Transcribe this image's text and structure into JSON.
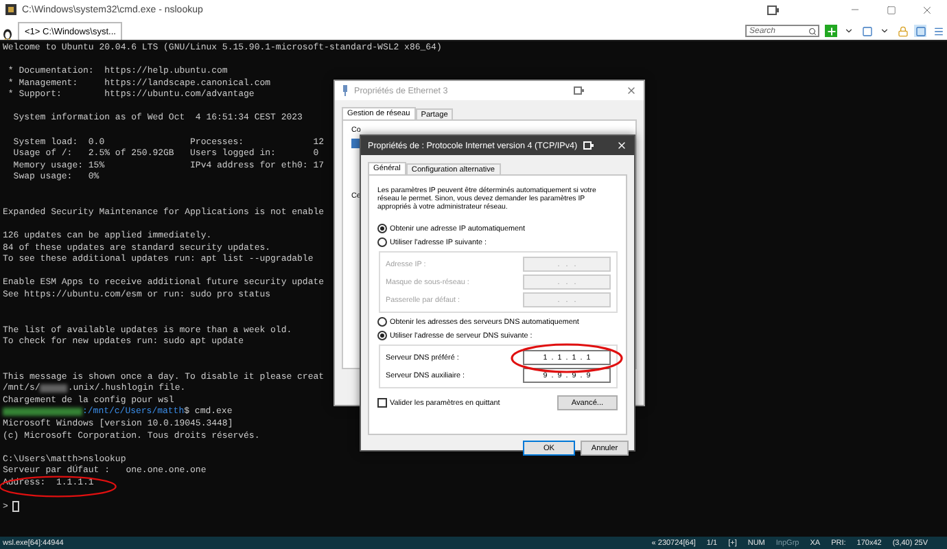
{
  "window": {
    "title": "C:\\Windows\\system32\\cmd.exe - nslookup"
  },
  "tabs": [
    {
      "label": "<1> C:\\Windows\\syst...",
      "selected": true
    }
  ],
  "search": {
    "placeholder": "Search"
  },
  "terminal": {
    "lines": [
      {
        "kind": "text",
        "text": "Welcome to Ubuntu 20.04.6 LTS (GNU/Linux 5.15.90.1-microsoft-standard-WSL2 x86_64)"
      },
      {
        "kind": "blank"
      },
      {
        "kind": "text",
        "text": " * Documentation:  https://help.ubuntu.com"
      },
      {
        "kind": "text",
        "text": " * Management:     https://landscape.canonical.com"
      },
      {
        "kind": "text",
        "text": " * Support:        https://ubuntu.com/advantage"
      },
      {
        "kind": "blank"
      },
      {
        "kind": "text",
        "text": "  System information as of Wed Oct  4 16:51:34 CEST 2023"
      },
      {
        "kind": "blank"
      },
      {
        "kind": "text",
        "text": "  System load:  0.0                Processes:             12"
      },
      {
        "kind": "text",
        "text": "  Usage of /:   2.5% of 250.92GB   Users logged in:       0"
      },
      {
        "kind": "text",
        "text": "  Memory usage: 15%                IPv4 address for eth0: 17"
      },
      {
        "kind": "text",
        "text": "  Swap usage:   0%"
      },
      {
        "kind": "blank"
      },
      {
        "kind": "blank"
      },
      {
        "kind": "text",
        "text": "Expanded Security Maintenance for Applications is not enable"
      },
      {
        "kind": "blank"
      },
      {
        "kind": "text",
        "text": "126 updates can be applied immediately."
      },
      {
        "kind": "text",
        "text": "84 of these updates are standard security updates."
      },
      {
        "kind": "text",
        "text": "To see these additional updates run: apt list --upgradable"
      },
      {
        "kind": "blank"
      },
      {
        "kind": "text",
        "text": "Enable ESM Apps to receive additional future security update"
      },
      {
        "kind": "text",
        "text": "See https://ubuntu.com/esm or run: sudo pro status"
      },
      {
        "kind": "blank"
      },
      {
        "kind": "blank"
      },
      {
        "kind": "text",
        "text": "The list of available updates is more than a week old."
      },
      {
        "kind": "text",
        "text": "To check for new updates run: sudo apt update"
      },
      {
        "kind": "blank"
      },
      {
        "kind": "blank"
      },
      {
        "kind": "text",
        "text": "This message is shown once a day. To disable it please creat"
      },
      {
        "kind": "redacted",
        "before": "/mnt/s/",
        "after": ".unix/.hushlogin file."
      },
      {
        "kind": "text",
        "text": "Chargement de la config pour wsl"
      },
      {
        "kind": "prompt",
        "path": ":/mnt/c/Users/matth",
        "command": "$ cmd.exe"
      },
      {
        "kind": "text",
        "text": "Microsoft Windows [version 10.0.19045.3448]"
      },
      {
        "kind": "text",
        "text": "(c) Microsoft Corporation. Tous droits réservés."
      },
      {
        "kind": "blank"
      },
      {
        "kind": "text",
        "text": "C:\\Users\\matth>nslookup"
      },
      {
        "kind": "text",
        "text": "Serveur par dÚfaut :   one.one.one.one"
      },
      {
        "kind": "text",
        "text": "Address:  1.1.1.1"
      },
      {
        "kind": "blank"
      },
      {
        "kind": "cursor",
        "text": ">"
      }
    ]
  },
  "ethernet_dialog": {
    "title": "Propriétés de Ethernet 3",
    "tabs": [
      {
        "label": "Gestion de réseau",
        "selected": true
      },
      {
        "label": "Partage",
        "selected": false
      }
    ],
    "labels": [
      "Co",
      "Ce"
    ]
  },
  "ipv4_dialog": {
    "title": "Propriétés de : Protocole Internet version 4 (TCP/IPv4)",
    "tabs": [
      {
        "label": "Général",
        "selected": true
      },
      {
        "label": "Configuration alternative",
        "selected": false
      }
    ],
    "description": "Les paramètres IP peuvent être déterminés automatiquement si votre réseau le permet. Sinon, vous devez demander les paramètres IP appropriés à votre administrateur réseau.",
    "ip_options": [
      {
        "label": "Obtenir une adresse IP automatiquement",
        "selected": true
      },
      {
        "label": "Utiliser l'adresse IP suivante :",
        "selected": false
      }
    ],
    "ip_fields": [
      {
        "label": "Adresse IP :",
        "value": ".   .   .",
        "disabled": true
      },
      {
        "label": "Masque de sous-réseau :",
        "value": ".   .   .",
        "disabled": true
      },
      {
        "label": "Passerelle par défaut :",
        "value": ".   .   .",
        "disabled": true
      }
    ],
    "dns_options": [
      {
        "label": "Obtenir les adresses des serveurs DNS automatiquement",
        "selected": false
      },
      {
        "label": "Utiliser l'adresse de serveur DNS suivante :",
        "selected": true
      }
    ],
    "dns_fields": [
      {
        "label": "Serveur DNS préféré :",
        "value": "1  .  1  .  1  .  1",
        "disabled": false
      },
      {
        "label": "Serveur DNS auxiliaire :",
        "value": "9  .  9  .  9  .  9",
        "disabled": false
      }
    ],
    "validate": {
      "label": "Valider les paramètres en quittant",
      "checked": false
    },
    "advanced_button": "Avancé...",
    "buttons": [
      "OK",
      "Annuler"
    ]
  },
  "status_bar": {
    "left": "wsl.exe[64]:44944",
    "items": [
      {
        "text": "« 230724[64]",
        "disabled": false
      },
      {
        "text": "1/1",
        "disabled": false
      },
      {
        "text": "[+]",
        "disabled": false
      },
      {
        "text": "NUM",
        "disabled": false
      },
      {
        "text": "InpGrp",
        "disabled": true
      },
      {
        "text": "XA",
        "disabled": false
      },
      {
        "text": "PRI:",
        "disabled": false
      },
      {
        "text": "170x42",
        "disabled": false
      },
      {
        "text": "(3,40) 25V",
        "disabled": false
      }
    ]
  }
}
